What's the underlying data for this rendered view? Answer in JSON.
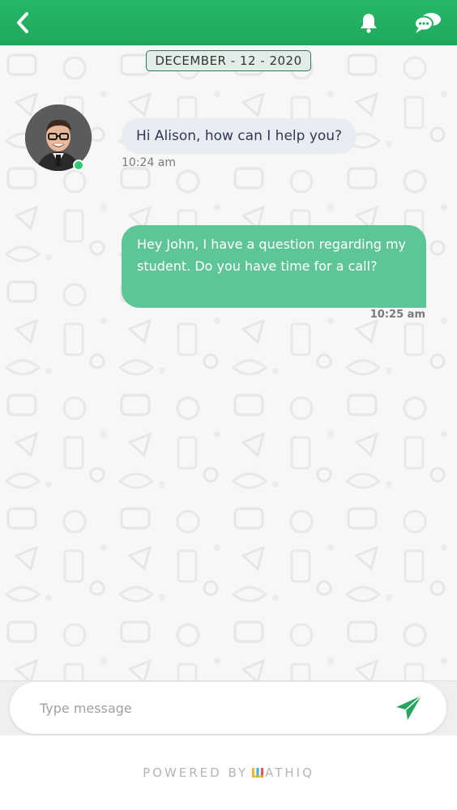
{
  "header": {
    "icons": [
      "chevron-left-icon",
      "bell-icon",
      "chat-bubbles-icon"
    ],
    "bg_color": "#22b062"
  },
  "chat": {
    "date": "DECEMBER - 12 - 2020",
    "messages": [
      {
        "direction": "incoming",
        "text": "Hi Alison, how can I help you?",
        "time": "10:24 am"
      },
      {
        "direction": "outgoing",
        "text": "Hey John, I have a question regarding my student. Do you have time for a call?",
        "time": "10:25 am"
      }
    ],
    "outgoing_color": "#5ec596",
    "incoming_color": "#e9ecf3",
    "online_color": "#2ecc71"
  },
  "composer": {
    "placeholder": "Type message",
    "send_icon": "send-icon",
    "send_color": "#27a35f"
  },
  "footer": {
    "powered_by": "POWERED BY",
    "brand": "ATHIQ"
  }
}
